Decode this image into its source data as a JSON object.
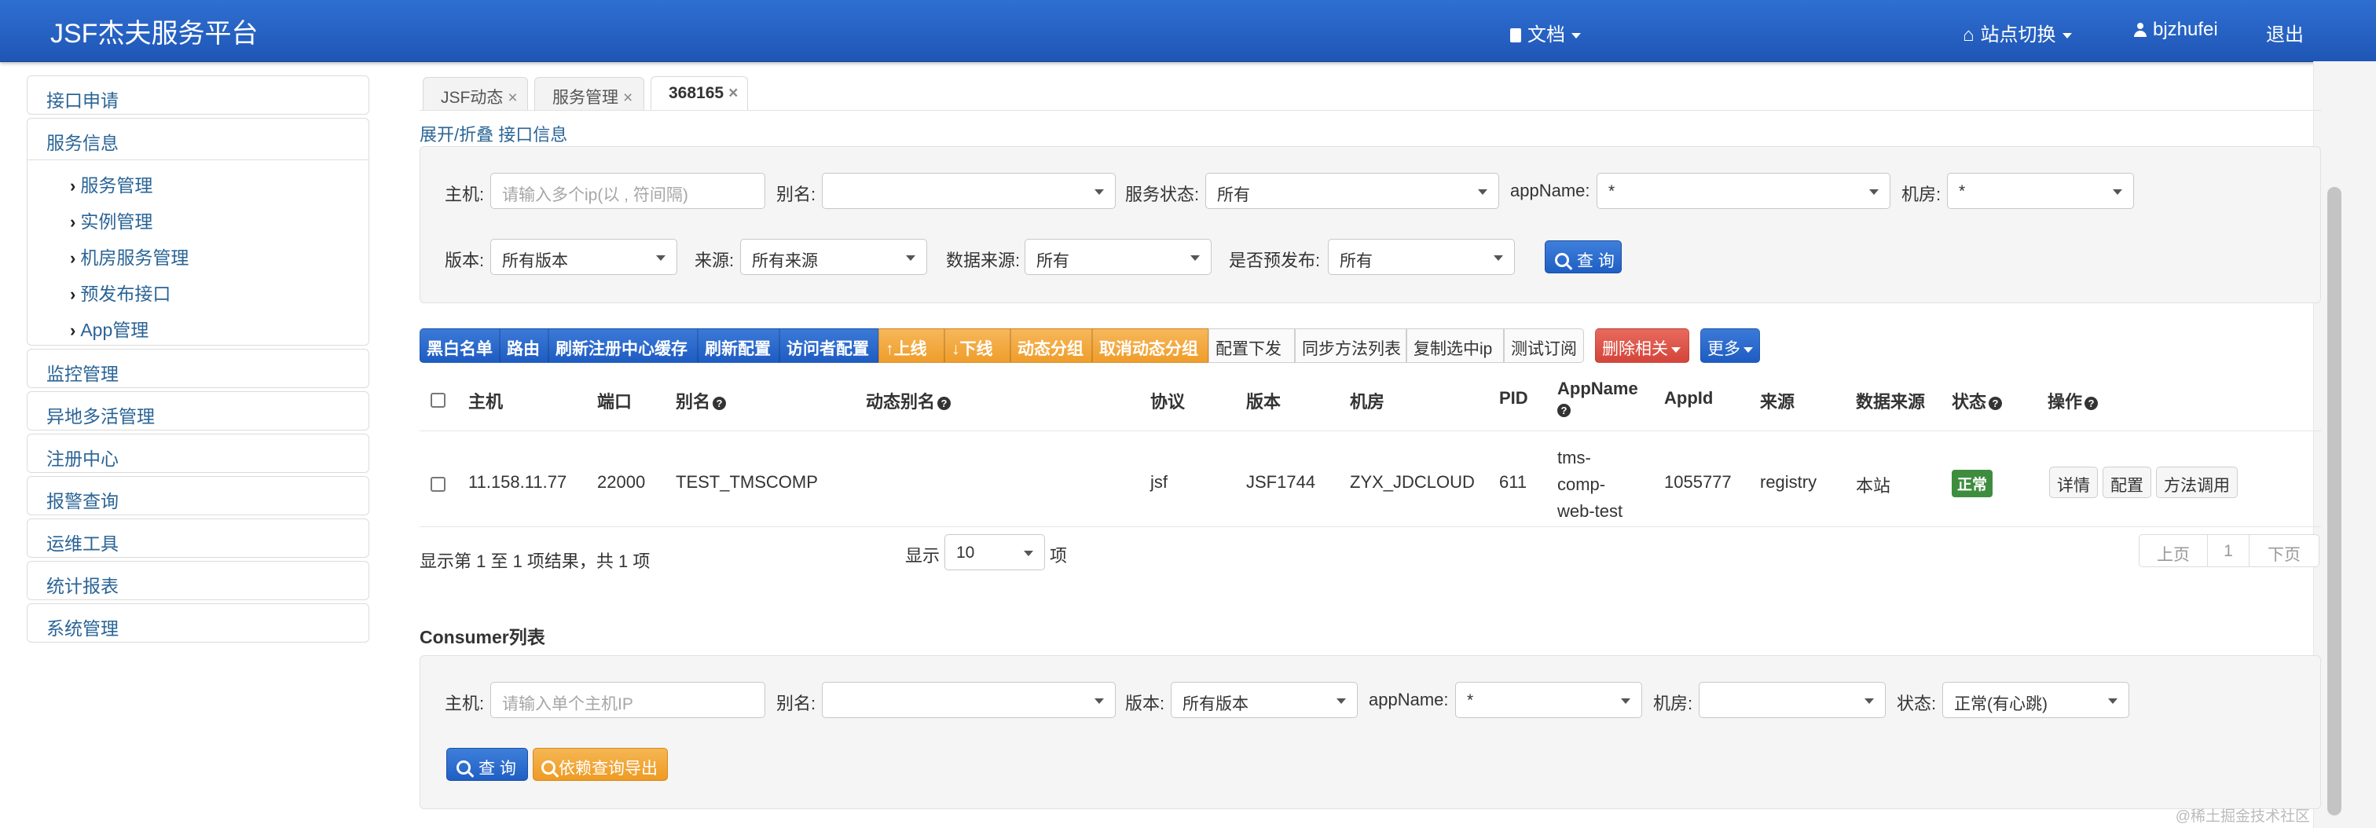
{
  "header": {
    "brand": "JSF杰夫服务平台",
    "docs": "文档",
    "site_switch": "站点切换",
    "user": "bjzhufei",
    "logout": "退出"
  },
  "sidebar": {
    "interface_apply": "接口申请",
    "service_info": "服务信息",
    "sub_items": [
      "服务管理",
      "实例管理",
      "机房服务管理",
      "预发布接口",
      "App管理"
    ],
    "monitor": "监控管理",
    "multi_active": "异地多活管理",
    "registry": "注册中心",
    "alarm": "报警查询",
    "ops_tools": "运维工具",
    "stats": "统计报表",
    "system": "系统管理"
  },
  "tabs": [
    "JSF动态",
    "服务管理",
    "368165"
  ],
  "tab_close": "×",
  "breadcrumb": {
    "toggle": "展开/折叠",
    "info": "接口信息"
  },
  "provider_filter": {
    "host_label": "主机:",
    "host_placeholder": "请输入多个ip(以 , 符间隔)",
    "alias_label": "别名:",
    "alias_value": "",
    "status_label": "服务状态:",
    "status_value": "所有",
    "appname_label": "appName:",
    "appname_value": "*",
    "room_label": "机房:",
    "room_value": "*",
    "version_label": "版本:",
    "version_value": "所有版本",
    "source_label": "来源:",
    "source_value": "所有来源",
    "datasource_label": "数据来源:",
    "datasource_value": "所有",
    "prerelease_label": "是否预发布:",
    "prerelease_value": "所有",
    "query_button": "查 询"
  },
  "toolbar": {
    "blacklist": "黑白名单",
    "route": "路由",
    "refresh_registry": "刷新注册中心缓存",
    "refresh_config": "刷新配置",
    "visitor_config": "访问者配置",
    "online": "上线",
    "offline": "下线",
    "dynamic_group": "动态分组",
    "cancel_dynamic_group": "取消动态分组",
    "config_push": "配置下发",
    "sync_methods": "同步方法列表",
    "copy_ip": "复制选中ip",
    "test_subscribe": "测试订阅",
    "delete_related": "删除相关",
    "more": "更多"
  },
  "table": {
    "headers": {
      "host": "主机",
      "port": "端口",
      "alias": "别名",
      "dynamic_alias": "动态别名",
      "protocol": "协议",
      "version": "版本",
      "room": "机房",
      "pid": "PID",
      "appname": "AppName",
      "appid": "AppId",
      "source": "来源",
      "datasource": "数据来源",
      "status": "状态",
      "actions": "操作"
    },
    "help_mark": "?",
    "row": {
      "host": "11.158.11.77",
      "port": "22000",
      "alias": "TEST_TMSCOMP",
      "dynamic_alias": "",
      "protocol": "jsf",
      "version": "JSF1744",
      "room": "ZYX_JDCLOUD",
      "pid": "611",
      "appname_lines": [
        "tms-",
        "comp-",
        "web-test"
      ],
      "appid": "1055777",
      "source": "registry",
      "datasource": "本站",
      "status": "正常",
      "actions": [
        "详情",
        "配置",
        "方法调用"
      ]
    },
    "summary": "显示第 1 至 1 项结果，共 1 项",
    "page_size_prefix": "显示",
    "page_size": "10",
    "page_size_suffix": "项",
    "pager": {
      "prev": "上页",
      "current": "1",
      "next": "下页"
    }
  },
  "consumer": {
    "title": "Consumer列表",
    "host_label": "主机:",
    "host_placeholder": "请输入单个主机IP",
    "alias_label": "别名:",
    "alias_value": "",
    "version_label": "版本:",
    "version_value": "所有版本",
    "appname_label": "appName:",
    "appname_value": "*",
    "room_label": "机房:",
    "room_value": "",
    "status_label": "状态:",
    "status_value": "正常(有心跳)",
    "query_button": "查 询",
    "export_button": "依赖查询导出"
  },
  "watermark": "@稀土掘金技术社区",
  "colors": {
    "header": "#2462c4",
    "primary": "#1f5fc4",
    "warning": "#ef9d2a",
    "danger": "#d4443a",
    "success": "#3e8d3e",
    "link": "#2a6496"
  }
}
